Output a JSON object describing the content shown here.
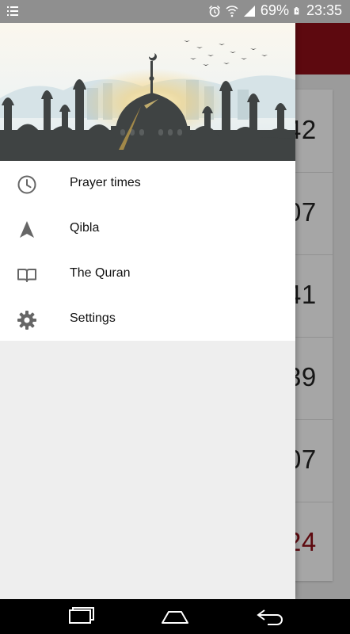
{
  "status_bar": {
    "battery": "69%",
    "time": "23:35",
    "icons": [
      "list-icon",
      "alarm-icon",
      "wifi-icon",
      "signal-icon",
      "battery-icon"
    ]
  },
  "colors": {
    "accent": "#8f0f17",
    "status_bar": "#8f8f8f",
    "drawer_header_dark": "#3f3f3f"
  },
  "background": {
    "times": [
      "42",
      "07",
      "41",
      "39",
      "07",
      "24"
    ],
    "highlighted_index": 5
  },
  "drawer": {
    "items": [
      {
        "label": "Prayer times",
        "icon": "clock-icon"
      },
      {
        "label": "Qibla",
        "icon": "navigation-arrow-icon"
      },
      {
        "label": "The Quran",
        "icon": "book-icon"
      },
      {
        "label": "Settings",
        "icon": "gear-icon"
      }
    ]
  },
  "nav_bar": {
    "buttons": [
      "recents-icon",
      "home-icon",
      "back-icon"
    ]
  }
}
